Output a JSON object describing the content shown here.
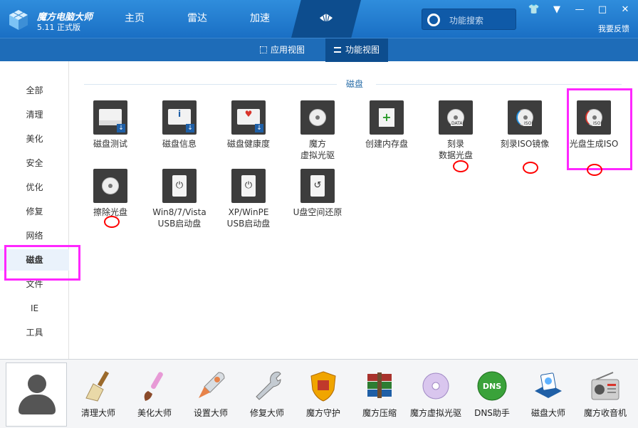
{
  "app": {
    "name": "魔方电脑大师",
    "version": "5.11 正式版"
  },
  "topnav": [
    {
      "label": "主页"
    },
    {
      "label": "雷达"
    },
    {
      "label": "加速"
    }
  ],
  "search": {
    "placeholder": "功能搜索"
  },
  "window_controls": [
    "👕",
    "▼",
    "—",
    "□",
    "✕"
  ],
  "feedback": "我要反馈",
  "subnav": {
    "app_view": "应用视图",
    "func_view": "功能视图"
  },
  "sidebar": [
    {
      "label": "全部"
    },
    {
      "label": "清理"
    },
    {
      "label": "美化"
    },
    {
      "label": "安全"
    },
    {
      "label": "优化"
    },
    {
      "label": "修复"
    },
    {
      "label": "网络"
    },
    {
      "label": "磁盘"
    },
    {
      "label": "文件"
    },
    {
      "label": "IE"
    },
    {
      "label": "工具"
    }
  ],
  "section": {
    "title": "磁盘"
  },
  "tools": [
    {
      "label": "磁盘测试",
      "icon": "drive-test-icon"
    },
    {
      "label": "磁盘信息",
      "icon": "drive-info-icon"
    },
    {
      "label": "磁盘健康度",
      "icon": "drive-health-icon"
    },
    {
      "label": "魔方\n虚拟光驱",
      "icon": "virtual-drive-icon"
    },
    {
      "label": "创建内存盘",
      "icon": "ram-disk-icon"
    },
    {
      "label": "刻录\n数据光盘",
      "icon": "burn-data-disc-icon",
      "tag": "DATA"
    },
    {
      "label": "刻录ISO镜像",
      "icon": "burn-iso-icon",
      "tag": "ISO"
    },
    {
      "label": "光盘生成ISO",
      "icon": "disc-to-iso-icon",
      "tag": "ISO"
    },
    {
      "label": "擦除光盘",
      "icon": "erase-disc-icon"
    },
    {
      "label": "Win8/7/Vista\nUSB启动盘",
      "icon": "usb-boot-win-icon"
    },
    {
      "label": "XP/WinPE\nUSB启动盘",
      "icon": "usb-boot-xp-icon"
    },
    {
      "label": "U盘空间还原",
      "icon": "usb-restore-icon"
    }
  ],
  "dock": [
    {
      "label": "清理大师",
      "icon": "broom-icon",
      "color": "#e9d9a8"
    },
    {
      "label": "美化大师",
      "icon": "brush-icon",
      "color": "#e79ad6"
    },
    {
      "label": "设置大师",
      "icon": "rocket-icon",
      "color": "#e7834a"
    },
    {
      "label": "修复大师",
      "icon": "wrench-icon",
      "color": "#c4cbd2"
    },
    {
      "label": "魔方守护",
      "icon": "shield-icon",
      "color": "#f0a500"
    },
    {
      "label": "魔方压缩",
      "icon": "books-icon",
      "color": "#a8322c"
    },
    {
      "label": "魔方虚拟光驱",
      "icon": "disc-icon",
      "color": "#d9c6ee"
    },
    {
      "label": "DNS助手",
      "icon": "dns-icon",
      "color": "#3aa23a"
    },
    {
      "label": "磁盘大师",
      "icon": "disk-master-icon",
      "color": "#1f5fa6"
    },
    {
      "label": "魔方收音机",
      "icon": "radio-icon",
      "color": "#cfcfcf"
    }
  ],
  "colors": {
    "titlebar": "#1a6fc4",
    "accent": "#0d4d8e",
    "highlight": "#ff27ff",
    "annotation": "#ff0000"
  }
}
